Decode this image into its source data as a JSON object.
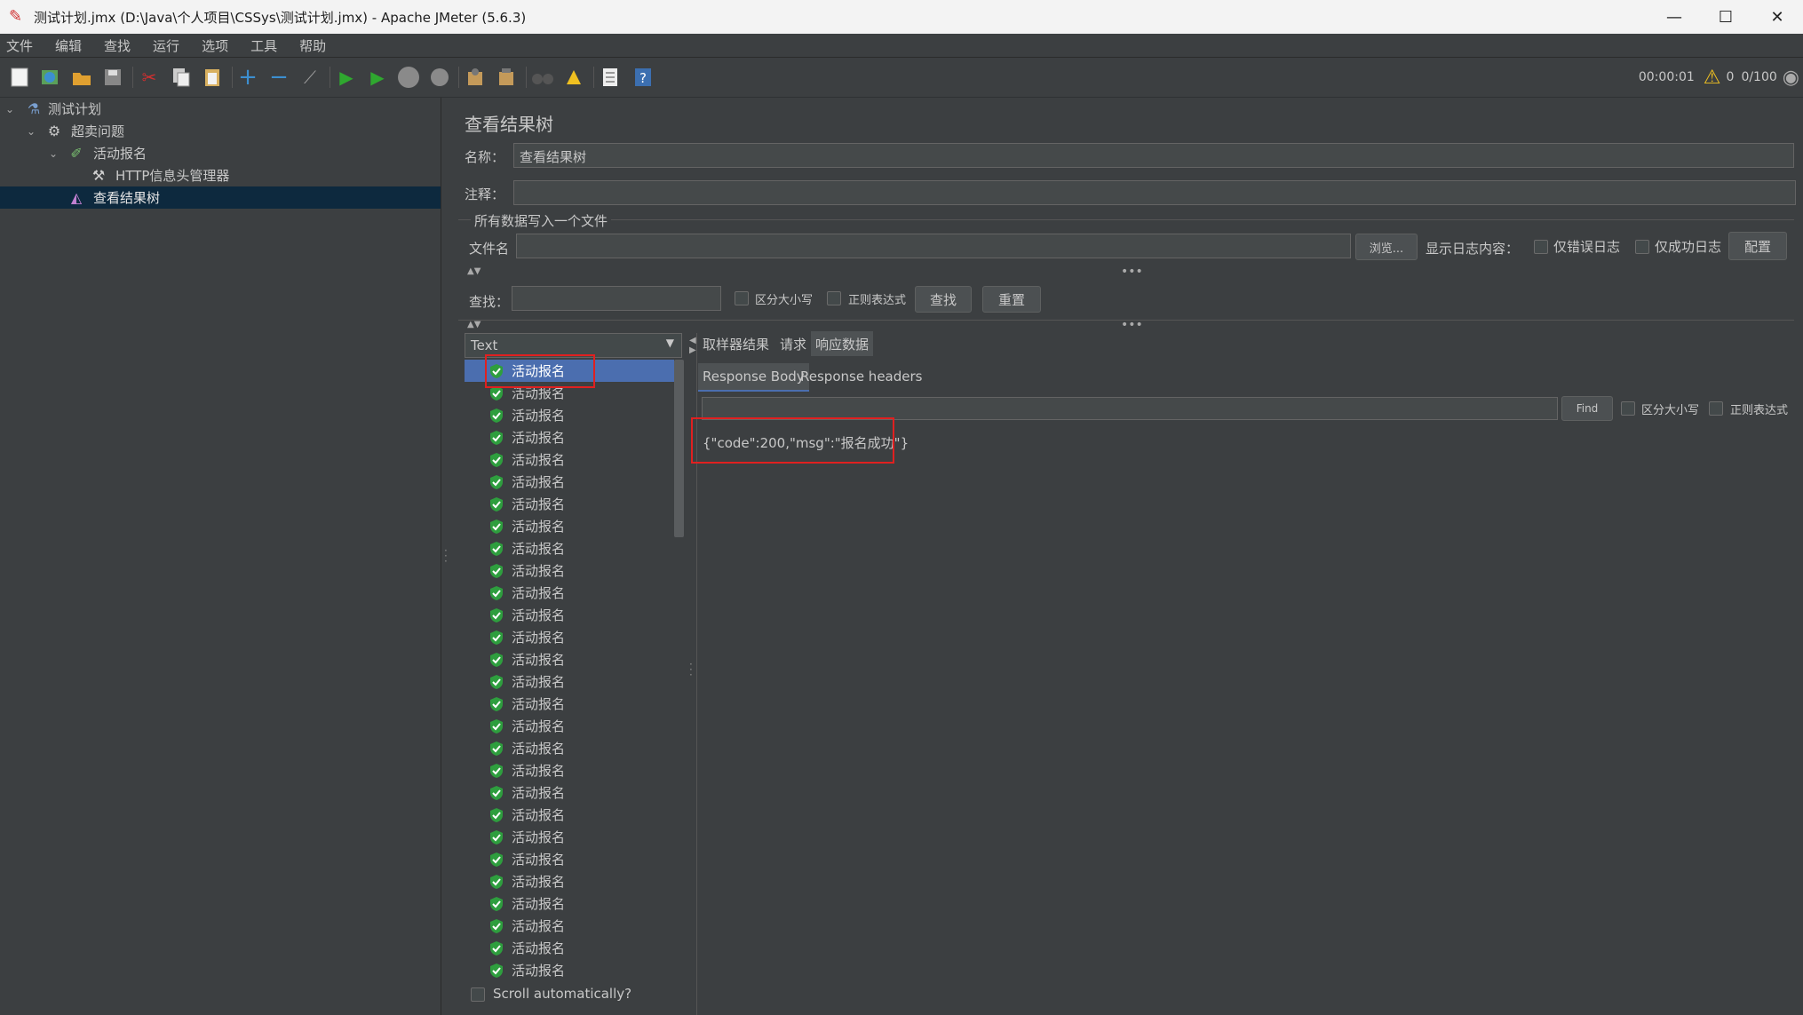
{
  "window": {
    "title": "测试计划.jmx (D:\\Java\\个人项目\\CSSys\\测试计划.jmx) - Apache JMeter (5.6.3)",
    "minimize": "—",
    "maximize": "☐",
    "close": "✕"
  },
  "menu": [
    "文件",
    "编辑",
    "查找",
    "运行",
    "选项",
    "工具",
    "帮助"
  ],
  "status": {
    "time": "00:00:01",
    "warnings": "0",
    "threads": "0/100"
  },
  "tree": [
    {
      "label": "测试计划",
      "icon": "flask-icon"
    },
    {
      "label": "超卖问题",
      "icon": "gear-icon"
    },
    {
      "label": "活动报名",
      "icon": "pipette-icon"
    },
    {
      "label": "HTTP信息头管理器",
      "icon": "tools-icon"
    },
    {
      "label": "查看结果树",
      "icon": "chart-icon"
    }
  ],
  "panel": {
    "heading": "查看结果树",
    "name_label": "名称：",
    "name_value": "查看结果树",
    "comment_label": "注释：",
    "comment_value": "",
    "file_group": "所有数据写入一个文件",
    "file_label": "文件名",
    "file_value": "",
    "browse": "浏览...",
    "log_label": "显示日志内容：",
    "errors_only": "仅错误日志",
    "success_only": "仅成功日志",
    "configure": "配置",
    "search_label": "查找：",
    "case_sensitive": "区分大小写",
    "regex": "正则表达式",
    "find_btn": "查找",
    "reset_btn": "重置"
  },
  "renderer": {
    "selected": "Text"
  },
  "results": {
    "item_label": "活动报名",
    "count": 28,
    "scroll_auto": "Scroll automatically?"
  },
  "tabs": [
    "取样器结果",
    "请求",
    "响应数据"
  ],
  "subtabs": [
    "Response Body",
    "Response headers"
  ],
  "response": {
    "find_btn": "Find",
    "case_sensitive": "区分大小写",
    "regex": "正则表达式",
    "body": "{\"code\":200,\"msg\":\"报名成功\"}"
  }
}
